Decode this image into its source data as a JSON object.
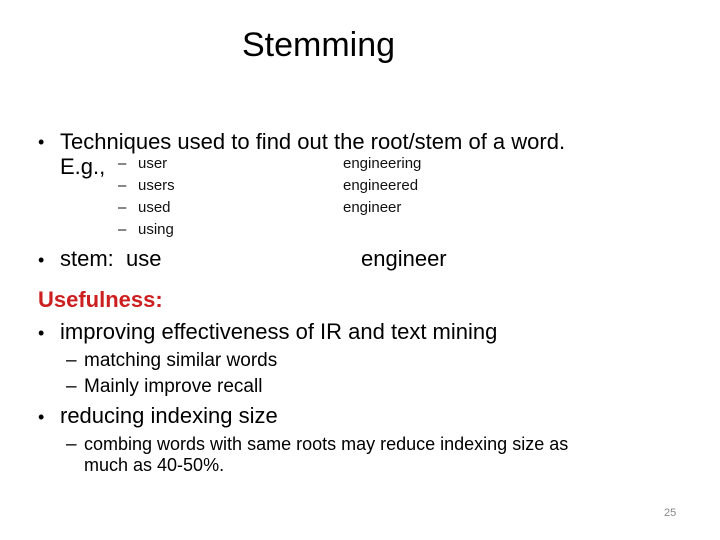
{
  "slide": {
    "title": "Stemming",
    "bullet1": {
      "marker": "•",
      "text_line1": "Techniques used to find out the root/stem of a word.",
      "text_line2": "E.g.,"
    },
    "examples_left": [
      {
        "dash": "–",
        "word": "user"
      },
      {
        "dash": "–",
        "word": "users"
      },
      {
        "dash": "–",
        "word": "used"
      },
      {
        "dash": "–",
        "word": "using"
      }
    ],
    "examples_right": [
      "engineering",
      "engineered",
      "engineer"
    ],
    "stem_bullet": {
      "marker": "•",
      "label": "stem:  use",
      "right": "engineer"
    },
    "usefulness": {
      "heading": "Usefulness:",
      "items": [
        {
          "marker": "•",
          "text": "improving effectiveness of IR and text mining",
          "subitems": [
            {
              "dash": "–",
              "text": "matching similar words"
            },
            {
              "dash": "–",
              "text": "Mainly improve recall"
            }
          ]
        },
        {
          "marker": "•",
          "text": "reducing indexing size",
          "subitems": [
            {
              "dash": "–",
              "text": "combing words with same roots may reduce indexing size as",
              "text2": "much as 40-50%."
            }
          ]
        }
      ]
    },
    "page_number": "25",
    "accent_color": "#cc1f1f"
  }
}
